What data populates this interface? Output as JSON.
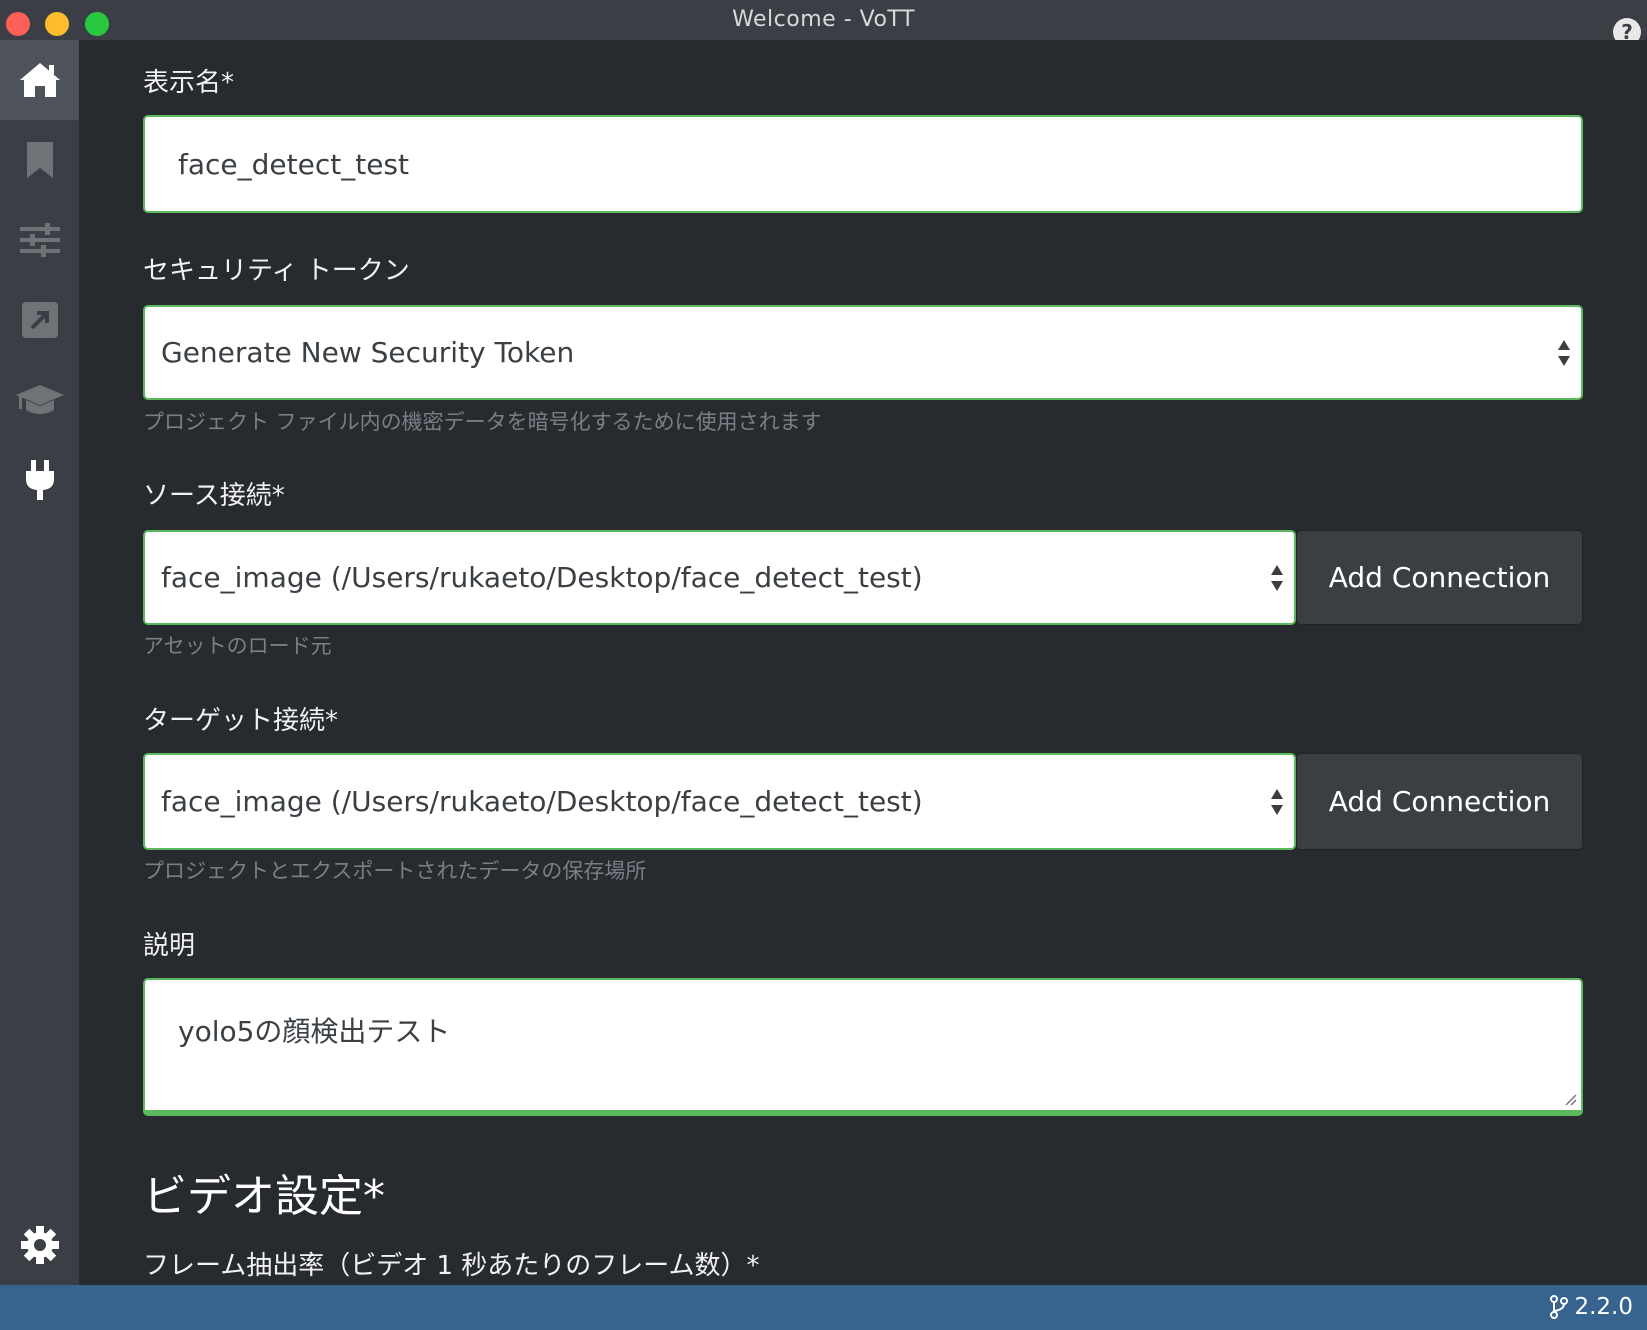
{
  "window": {
    "title": "Welcome - VoTT"
  },
  "sidebar": {
    "items": [
      {
        "icon": "home-icon",
        "active": true
      },
      {
        "icon": "bookmark-icon"
      },
      {
        "icon": "sliders-icon"
      },
      {
        "icon": "export-icon"
      },
      {
        "icon": "graduation-cap-icon"
      },
      {
        "icon": "plug-icon"
      }
    ],
    "settings_icon": "gear-icon"
  },
  "form": {
    "display_name": {
      "label": "表示名*",
      "value": "face_detect_test"
    },
    "security_token": {
      "label": "セキュリティ トークン",
      "selected": "Generate New Security Token",
      "help": "プロジェクト ファイル内の機密データを暗号化するために使用されます"
    },
    "source_connection": {
      "label": "ソース接続*",
      "selected": "face_image (/Users/rukaeto/Desktop/face_detect_test)",
      "button": "Add Connection",
      "help": "アセットのロード元"
    },
    "target_connection": {
      "label": "ターゲット接続*",
      "selected": "face_image (/Users/rukaeto/Desktop/face_detect_test)",
      "button": "Add Connection",
      "help": "プロジェクトとエクスポートされたデータの保存場所"
    },
    "description": {
      "label": "説明",
      "value": "yolo5の顔検出テスト"
    },
    "video_settings": {
      "title": "ビデオ設定*",
      "frame_rate_label": "フレーム抽出率（ビデオ 1 秒あたりのフレーム数）*"
    }
  },
  "statusbar": {
    "version": "2.2.0"
  },
  "colors": {
    "accent_valid": "#5cb85c",
    "statusbar": "#36648f",
    "sidebar": "#3b3f45",
    "background": "#272b30"
  }
}
